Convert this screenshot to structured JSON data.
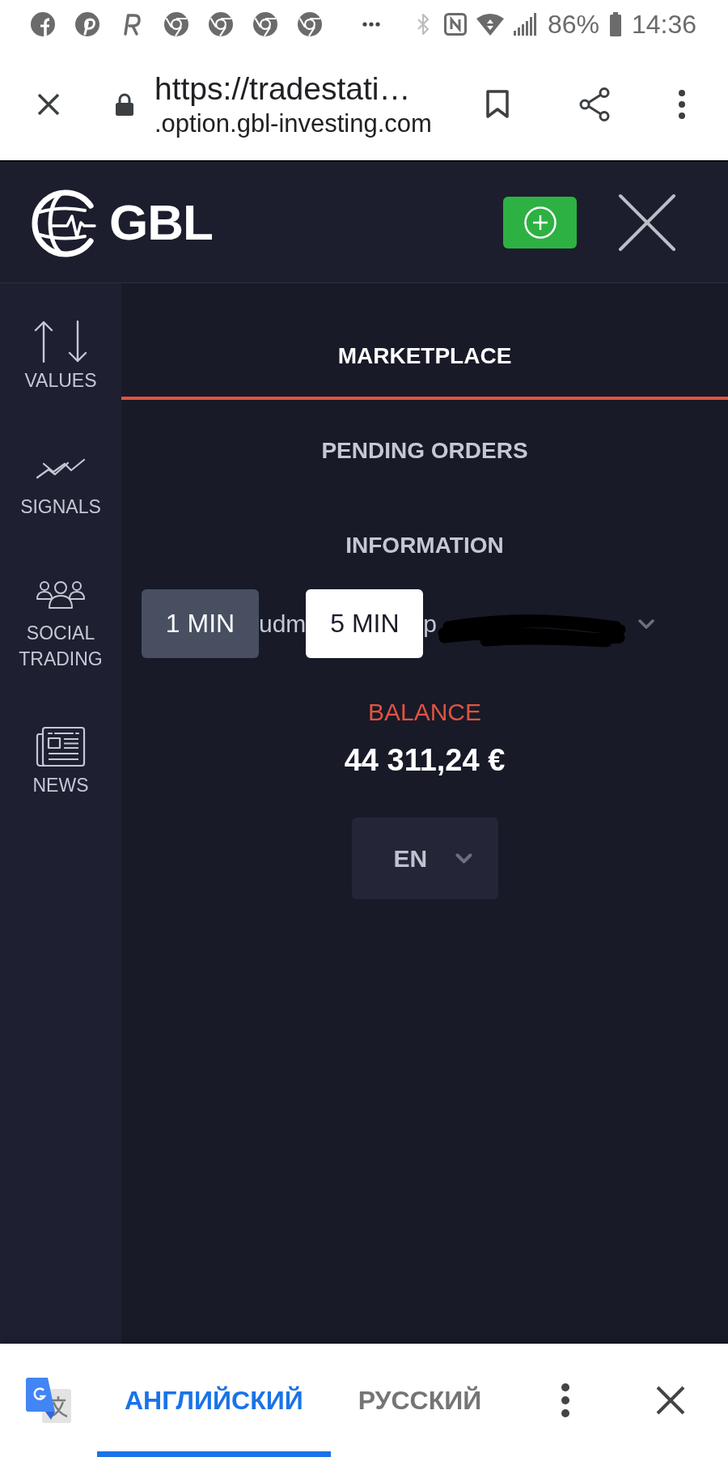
{
  "status_bar": {
    "battery_percent": "86%",
    "time": "14:36"
  },
  "browser_bar": {
    "url_title": "https://tradestati…",
    "url_host": ".option.gbl-investing.com"
  },
  "header": {
    "logo_text": "GBL"
  },
  "sidebar": {
    "items": [
      {
        "label": "VALUES"
      },
      {
        "label": "SIGNALS"
      },
      {
        "label": "SOCIAL TRADING"
      },
      {
        "label": "NEWS"
      }
    ]
  },
  "menu": {
    "tabs": [
      {
        "label": "MARKETPLACE",
        "selected": true
      },
      {
        "label": "PENDING ORDERS",
        "selected": false
      },
      {
        "label": "INFORMATION",
        "selected": false
      }
    ]
  },
  "account_row": {
    "items": [
      {
        "kind": "button",
        "label": "1 MIN",
        "selected": false
      },
      {
        "kind": "text",
        "text": "udm"
      },
      {
        "kind": "button",
        "label": "5 MIN",
        "selected": true
      },
      {
        "kind": "text",
        "text": "p"
      },
      {
        "kind": "redaction"
      }
    ]
  },
  "balance": {
    "label": "BALANCE",
    "amount": "44 311,24 €"
  },
  "language_select": {
    "value": "EN"
  },
  "translate_bar": {
    "languages": [
      {
        "label": "АНГЛИЙСКИЙ",
        "selected": true
      },
      {
        "label": "РУССКИЙ",
        "selected": false
      }
    ]
  }
}
